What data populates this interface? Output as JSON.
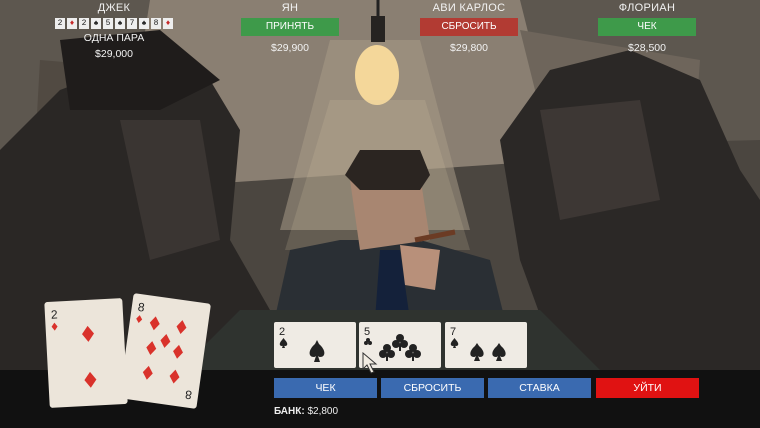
{
  "players": [
    {
      "name": "ДЖЕК",
      "hand_rank": "ОДНА ПАРА",
      "chips": "$29,000",
      "best_hand": [
        {
          "rank": "2",
          "suit": "♦",
          "suit_name": "diamond"
        },
        {
          "rank": "2",
          "suit": "♠",
          "suit_name": "spade"
        },
        {
          "rank": "5",
          "suit": "♠",
          "suit_name": "spade"
        },
        {
          "rank": "7",
          "suit": "♠",
          "suit_name": "spade"
        },
        {
          "rank": "8",
          "suit": "♦",
          "suit_name": "diamond"
        }
      ]
    },
    {
      "name": "ЯН",
      "action": "ПРИНЯТЬ",
      "action_color": "#3e9a4a",
      "chips": "$29,900"
    },
    {
      "name": "АВИ КАРЛОС",
      "action": "СБРОСИТЬ",
      "action_color": "#b23b33",
      "chips": "$29,800"
    },
    {
      "name": "ФЛОРИАН",
      "action": "ЧЕК",
      "action_color": "#3e9a4a",
      "chips": "$28,500"
    }
  ],
  "hole_cards": [
    {
      "rank": "2",
      "suit": "♦",
      "suit_name": "diamond"
    },
    {
      "rank": "8",
      "suit": "♦",
      "suit_name": "diamond"
    }
  ],
  "community_cards": [
    {
      "rank": "2",
      "suit": "♠",
      "suit_name": "spade"
    },
    {
      "rank": "5",
      "suit": "♣",
      "suit_name": "club"
    },
    {
      "rank": "7",
      "suit": "♠",
      "suit_name": "spade"
    }
  ],
  "controls": {
    "check": "ЧЕК",
    "fold": "СБРОСИТЬ",
    "bet": "СТАВКА",
    "leave": "УЙТИ",
    "button_color": "#3a6ab0",
    "leave_color": "#e01212"
  },
  "pot": {
    "label": "БАНК:",
    "value": "$2,800"
  }
}
